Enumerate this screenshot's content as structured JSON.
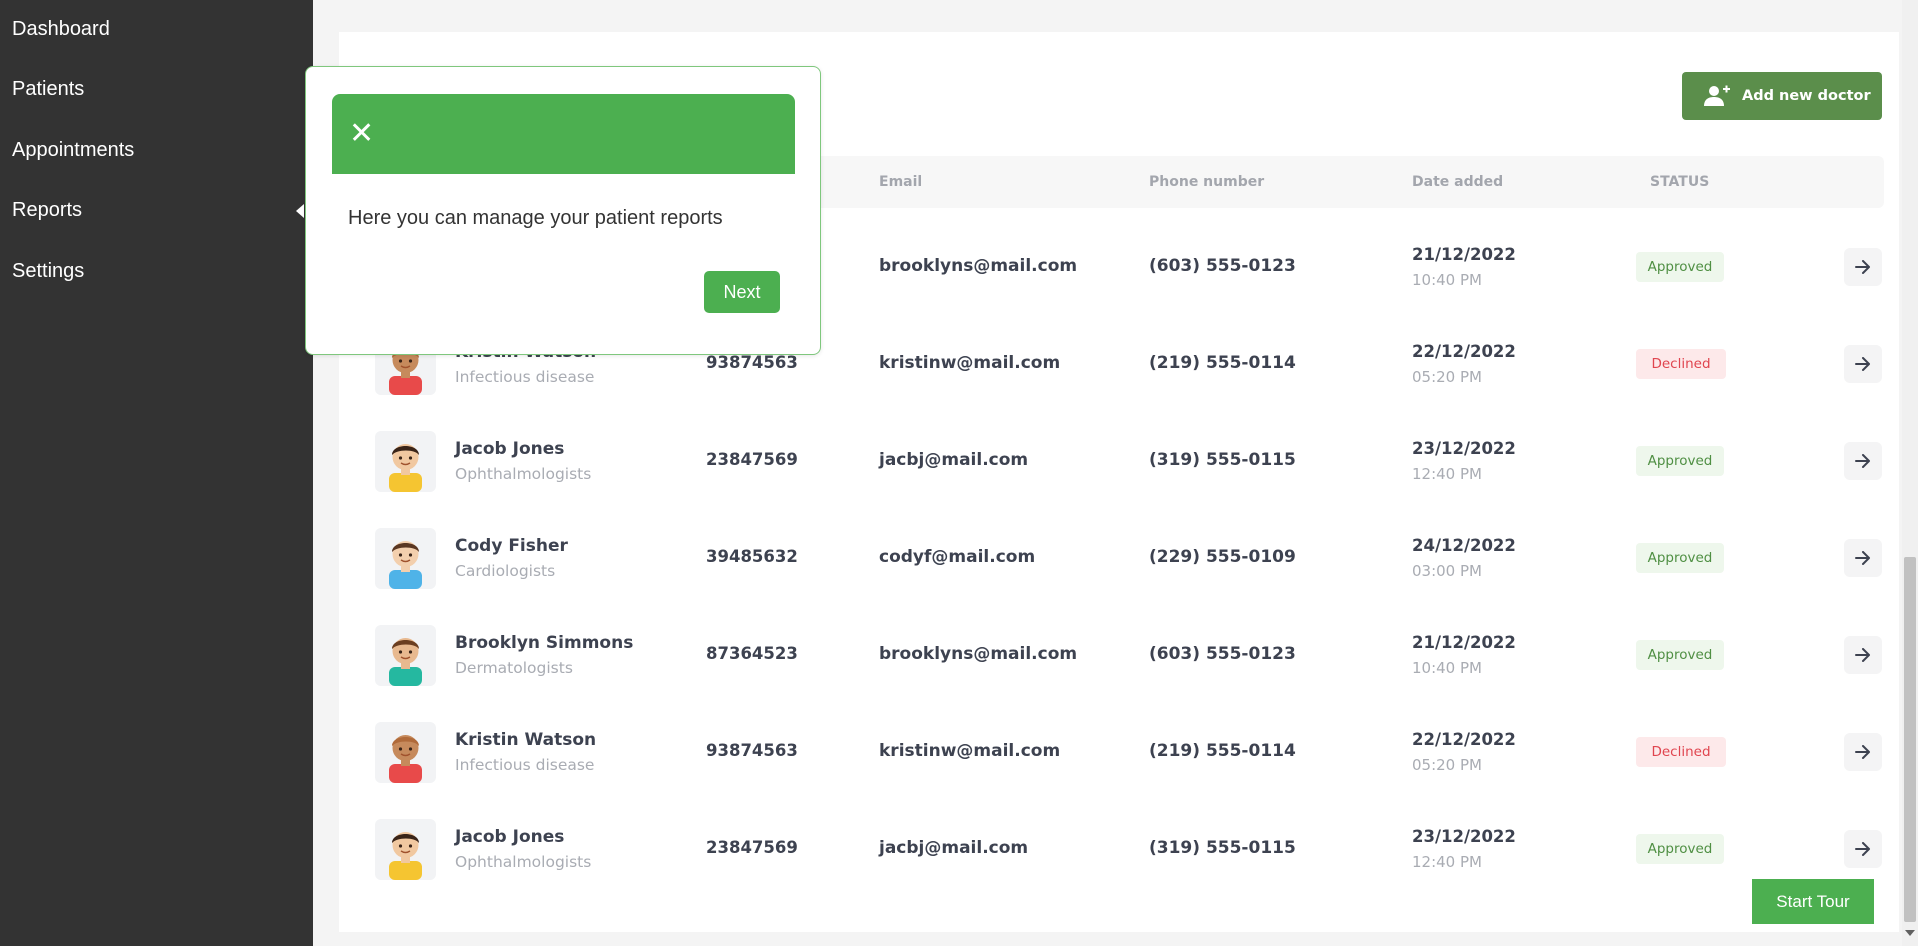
{
  "sidebar": {
    "items": [
      {
        "label": "Dashboard"
      },
      {
        "label": "Patients"
      },
      {
        "label": "Appointments"
      },
      {
        "label": "Reports"
      },
      {
        "label": "Settings"
      }
    ]
  },
  "toolbar": {
    "add_label": "Add new doctor",
    "add_icon": "add-user-icon"
  },
  "table": {
    "headers": {
      "email": "Email",
      "phone": "Phone number",
      "date": "Date added",
      "status": "STATUS"
    },
    "rows": [
      {
        "name": "",
        "specialty": "",
        "id": "",
        "email": "brooklyns@mail.com",
        "phone": "(603) 555-0123",
        "date": "21/12/2022",
        "time": "10:40 PM",
        "status": "Approved"
      },
      {
        "name": "Kristin Watson",
        "specialty": "Infectious disease",
        "id": "93874563",
        "email": "kristinw@mail.com",
        "phone": "(219) 555-0114",
        "date": "22/12/2022",
        "time": "05:20 PM",
        "status": "Declined"
      },
      {
        "name": "Jacob Jones",
        "specialty": "Ophthalmologists",
        "id": "23847569",
        "email": "jacbj@mail.com",
        "phone": "(319) 555-0115",
        "date": "23/12/2022",
        "time": "12:40 PM",
        "status": "Approved"
      },
      {
        "name": "Cody Fisher",
        "specialty": "Cardiologists",
        "id": "39485632",
        "email": "codyf@mail.com",
        "phone": "(229) 555-0109",
        "date": "24/12/2022",
        "time": "03:00 PM",
        "status": "Approved"
      },
      {
        "name": "Brooklyn Simmons",
        "specialty": "Dermatologists",
        "id": "87364523",
        "email": "brooklyns@mail.com",
        "phone": "(603) 555-0123",
        "date": "21/12/2022",
        "time": "10:40 PM",
        "status": "Approved"
      },
      {
        "name": "Kristin Watson",
        "specialty": "Infectious disease",
        "id": "93874563",
        "email": "kristinw@mail.com",
        "phone": "(219) 555-0114",
        "date": "22/12/2022",
        "time": "05:20 PM",
        "status": "Declined"
      },
      {
        "name": "Jacob Jones",
        "specialty": "Ophthalmologists",
        "id": "23847569",
        "email": "jacbj@mail.com",
        "phone": "(319) 555-0115",
        "date": "23/12/2022",
        "time": "12:40 PM",
        "status": "Approved"
      }
    ]
  },
  "tour": {
    "close_symbol": "✕",
    "message": "Here you can manage your patient reports",
    "next_label": "Next",
    "start_label": "Start Tour"
  },
  "colors": {
    "sidebar_bg": "#333333",
    "accent_green": "#4caf50",
    "add_button": "#5b8e4b",
    "approved_text": "#4f8f43",
    "declined_text": "#e0454f"
  }
}
